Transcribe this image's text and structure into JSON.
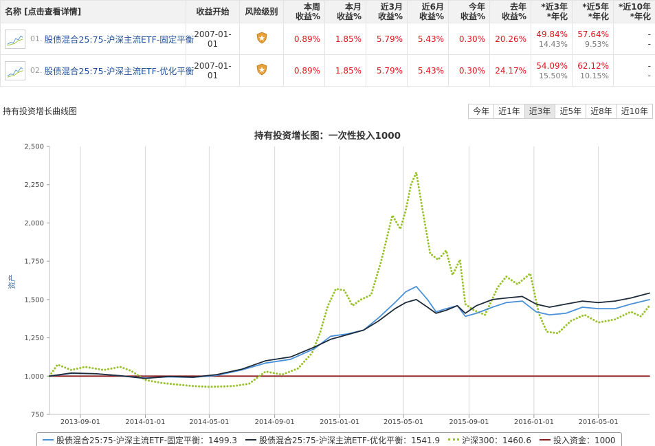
{
  "table": {
    "headers": {
      "name": "名称 [点击查看详情]",
      "start": "收益开始",
      "risk": "风险级别",
      "week": [
        "本周",
        "收益%"
      ],
      "month": [
        "本月",
        "收益%"
      ],
      "m3": [
        "近3月",
        "收益%"
      ],
      "m6": [
        "近6月",
        "收益%"
      ],
      "ytd": [
        "今年",
        "收益%"
      ],
      "lastyear": [
        "去年",
        "收益%"
      ],
      "y3": [
        "*近3年",
        "*年化"
      ],
      "y5": [
        "*近5年",
        "*年化"
      ],
      "y10": [
        "*近10年",
        "*年化"
      ]
    },
    "rows": [
      {
        "index": "01.",
        "name": "股债混合25:75-沪深主流ETF-固定平衡",
        "start": "2007-01-01",
        "risk_icon": "shield-star-icon",
        "week": "0.89%",
        "month": "1.85%",
        "m3": "5.79%",
        "m6": "5.43%",
        "ytd": "0.30%",
        "lastyear": "20.26%",
        "y3_total": "49.84%",
        "y3_ann": "14.43%",
        "y5_total": "57.64%",
        "y5_ann": "9.53%",
        "y10_total": "-",
        "y10_ann": "-"
      },
      {
        "index": "02.",
        "name": "股债混合25:75-沪深主流ETF-优化平衡",
        "start": "2007-01-01",
        "risk_icon": "shield-star-icon",
        "week": "0.89%",
        "month": "1.85%",
        "m3": "5.79%",
        "m6": "5.43%",
        "ytd": "0.30%",
        "lastyear": "24.17%",
        "y3_total": "54.09%",
        "y3_ann": "15.50%",
        "y5_total": "62.12%",
        "y5_ann": "10.15%",
        "y10_total": "-",
        "y10_ann": "-"
      }
    ]
  },
  "section": {
    "title": "持有投资增长曲线图",
    "tabs": [
      "今年",
      "近1年",
      "近3年",
      "近5年",
      "近8年",
      "近10年"
    ],
    "active_tab": "近3年"
  },
  "colors": {
    "fixed": "#4a90d9",
    "optimized": "#1c2a3a",
    "csi300": "#99c22a",
    "invest": "#8b1a1a",
    "red_value": "#e0141e",
    "link": "#1f4e96"
  },
  "chart_data": {
    "type": "line",
    "title": "持有投资增长图：一次性投入1000",
    "ylabel": "资产",
    "xlabel": "",
    "ylim": [
      750,
      2500
    ],
    "yticks": [
      750,
      1000,
      1250,
      1500,
      1750,
      2000,
      2250,
      2500
    ],
    "ytick_labels": [
      "750",
      "1,000",
      "1,250",
      "1,500",
      "1,750",
      "2,000",
      "2,250",
      "2,500"
    ],
    "xlim": [
      "2013-07-05",
      "2016-08-05"
    ],
    "xticks": [
      "2013-09-01",
      "2014-01-01",
      "2014-05-01",
      "2014-09-01",
      "2015-01-01",
      "2015-05-01",
      "2015-09-01",
      "2016-01-01",
      "2016-05-01"
    ],
    "grid": "vertical",
    "legend_position": "bottom",
    "series": [
      {
        "name": "股债混合25:75-沪深主流ETF-固定平衡",
        "legend_label": "股债混合25:75-沪深主流ETF-固定平衡：1499.3",
        "style": "solid",
        "points": [
          [
            "2013-07-05",
            1000
          ],
          [
            "2013-08-15",
            1018
          ],
          [
            "2013-10-01",
            1015
          ],
          [
            "2013-11-15",
            1002
          ],
          [
            "2014-01-01",
            988
          ],
          [
            "2014-02-15",
            995
          ],
          [
            "2014-04-01",
            992
          ],
          [
            "2014-05-15",
            1005
          ],
          [
            "2014-07-01",
            1040
          ],
          [
            "2014-08-15",
            1085
          ],
          [
            "2014-10-01",
            1110
          ],
          [
            "2014-11-15",
            1180
          ],
          [
            "2014-12-15",
            1260
          ],
          [
            "2015-01-15",
            1275
          ],
          [
            "2015-02-15",
            1300
          ],
          [
            "2015-03-15",
            1380
          ],
          [
            "2015-04-15",
            1480
          ],
          [
            "2015-05-05",
            1550
          ],
          [
            "2015-05-25",
            1585
          ],
          [
            "2015-06-15",
            1500
          ],
          [
            "2015-07-01",
            1420
          ],
          [
            "2015-07-20",
            1440
          ],
          [
            "2015-08-10",
            1460
          ],
          [
            "2015-08-25",
            1390
          ],
          [
            "2015-09-15",
            1410
          ],
          [
            "2015-10-15",
            1450
          ],
          [
            "2015-11-10",
            1480
          ],
          [
            "2015-12-10",
            1490
          ],
          [
            "2016-01-05",
            1420
          ],
          [
            "2016-01-30",
            1400
          ],
          [
            "2016-03-01",
            1410
          ],
          [
            "2016-04-01",
            1450
          ],
          [
            "2016-05-01",
            1440
          ],
          [
            "2016-06-01",
            1440
          ],
          [
            "2016-07-01",
            1470
          ],
          [
            "2016-08-05",
            1499.3
          ]
        ]
      },
      {
        "name": "股债混合25:75-沪深主流ETF-优化平衡",
        "legend_label": "股债混合25:75-沪深主流ETF-优化平衡：1541.9",
        "style": "solid",
        "points": [
          [
            "2013-07-05",
            1000
          ],
          [
            "2013-08-15",
            1020
          ],
          [
            "2013-10-01",
            1015
          ],
          [
            "2013-11-15",
            1002
          ],
          [
            "2014-01-01",
            985
          ],
          [
            "2014-02-15",
            998
          ],
          [
            "2014-04-01",
            993
          ],
          [
            "2014-05-15",
            1010
          ],
          [
            "2014-07-01",
            1045
          ],
          [
            "2014-08-15",
            1100
          ],
          [
            "2014-10-01",
            1125
          ],
          [
            "2014-11-15",
            1190
          ],
          [
            "2014-12-15",
            1240
          ],
          [
            "2015-01-15",
            1270
          ],
          [
            "2015-02-15",
            1300
          ],
          [
            "2015-03-15",
            1360
          ],
          [
            "2015-04-15",
            1440
          ],
          [
            "2015-05-05",
            1480
          ],
          [
            "2015-05-25",
            1500
          ],
          [
            "2015-06-15",
            1450
          ],
          [
            "2015-07-01",
            1410
          ],
          [
            "2015-07-20",
            1430
          ],
          [
            "2015-08-10",
            1460
          ],
          [
            "2015-08-25",
            1410
          ],
          [
            "2015-09-15",
            1460
          ],
          [
            "2015-10-15",
            1500
          ],
          [
            "2015-11-10",
            1510
          ],
          [
            "2015-12-10",
            1520
          ],
          [
            "2016-01-05",
            1470
          ],
          [
            "2016-01-30",
            1450
          ],
          [
            "2016-03-01",
            1470
          ],
          [
            "2016-04-01",
            1490
          ],
          [
            "2016-05-01",
            1480
          ],
          [
            "2016-06-01",
            1490
          ],
          [
            "2016-07-01",
            1510
          ],
          [
            "2016-08-05",
            1541.9
          ]
        ]
      },
      {
        "name": "沪深300",
        "legend_label": "沪深300：1460.6",
        "style": "dotted",
        "points": [
          [
            "2013-07-05",
            1000
          ],
          [
            "2013-07-20",
            1075
          ],
          [
            "2013-08-15",
            1040
          ],
          [
            "2013-09-10",
            1060
          ],
          [
            "2013-10-15",
            1040
          ],
          [
            "2013-11-15",
            1060
          ],
          [
            "2013-12-05",
            1035
          ],
          [
            "2014-01-01",
            975
          ],
          [
            "2014-02-01",
            955
          ],
          [
            "2014-03-01",
            945
          ],
          [
            "2014-04-01",
            935
          ],
          [
            "2014-05-01",
            930
          ],
          [
            "2014-06-15",
            935
          ],
          [
            "2014-07-15",
            950
          ],
          [
            "2014-08-15",
            1030
          ],
          [
            "2014-09-15",
            1010
          ],
          [
            "2014-10-15",
            1050
          ],
          [
            "2014-11-10",
            1150
          ],
          [
            "2014-11-25",
            1280
          ],
          [
            "2014-12-10",
            1460
          ],
          [
            "2014-12-25",
            1570
          ],
          [
            "2015-01-10",
            1560
          ],
          [
            "2015-01-25",
            1460
          ],
          [
            "2015-02-10",
            1500
          ],
          [
            "2015-03-01",
            1530
          ],
          [
            "2015-03-20",
            1750
          ],
          [
            "2015-04-10",
            2050
          ],
          [
            "2015-04-25",
            1960
          ],
          [
            "2015-05-05",
            2080
          ],
          [
            "2015-05-15",
            2250
          ],
          [
            "2015-05-25",
            2330
          ],
          [
            "2015-06-05",
            2100
          ],
          [
            "2015-06-20",
            1800
          ],
          [
            "2015-07-05",
            1760
          ],
          [
            "2015-07-20",
            1820
          ],
          [
            "2015-08-01",
            1660
          ],
          [
            "2015-08-15",
            1760
          ],
          [
            "2015-08-25",
            1470
          ],
          [
            "2015-09-10",
            1430
          ],
          [
            "2015-10-01",
            1400
          ],
          [
            "2015-10-25",
            1580
          ],
          [
            "2015-11-10",
            1650
          ],
          [
            "2015-12-01",
            1600
          ],
          [
            "2015-12-25",
            1670
          ],
          [
            "2016-01-10",
            1410
          ],
          [
            "2016-01-25",
            1290
          ],
          [
            "2016-02-15",
            1280
          ],
          [
            "2016-03-10",
            1360
          ],
          [
            "2016-04-05",
            1400
          ],
          [
            "2016-05-01",
            1350
          ],
          [
            "2016-06-01",
            1370
          ],
          [
            "2016-07-01",
            1420
          ],
          [
            "2016-07-20",
            1390
          ],
          [
            "2016-08-05",
            1460.6
          ]
        ]
      },
      {
        "name": "投入资金",
        "legend_label": "投入资金：1000",
        "style": "solid",
        "points": [
          [
            "2013-07-05",
            1000
          ],
          [
            "2016-08-05",
            1000
          ]
        ]
      }
    ]
  }
}
